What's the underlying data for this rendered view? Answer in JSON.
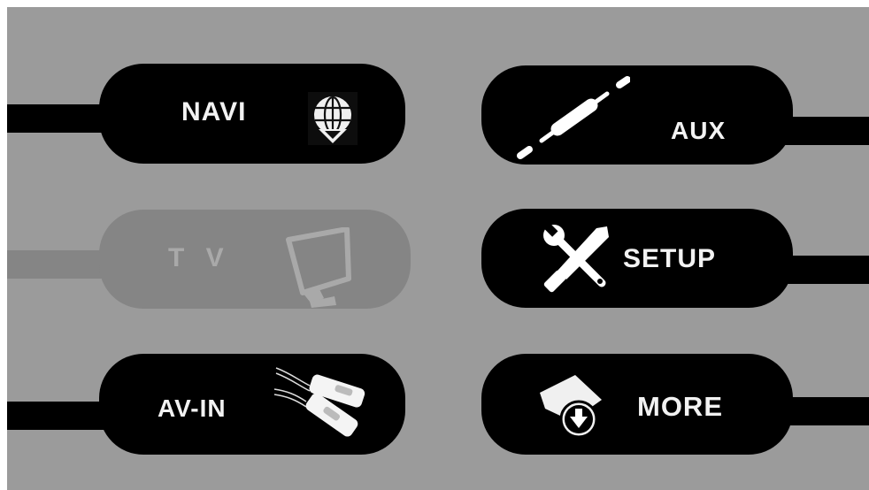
{
  "menu": {
    "navi": {
      "label": "NAVI",
      "icon": "globe-download-icon",
      "enabled": true
    },
    "aux": {
      "label": "AUX",
      "icon": "cable-icon",
      "enabled": true
    },
    "tv": {
      "label": "T V",
      "icon": "monitor-icon",
      "enabled": false
    },
    "setup": {
      "label": "SETUP",
      "icon": "wrench-screwdriver-icon",
      "enabled": true
    },
    "avin": {
      "label": "AV-IN",
      "icon": "rca-plugs-icon",
      "enabled": true
    },
    "more": {
      "label": "MORE",
      "icon": "box-download-icon",
      "enabled": true
    }
  },
  "colors": {
    "background": "#9b9b9b",
    "button": "#000000",
    "button_disabled": "#858585",
    "text": "#f2f2f2",
    "text_disabled": "#a9a9a9"
  }
}
